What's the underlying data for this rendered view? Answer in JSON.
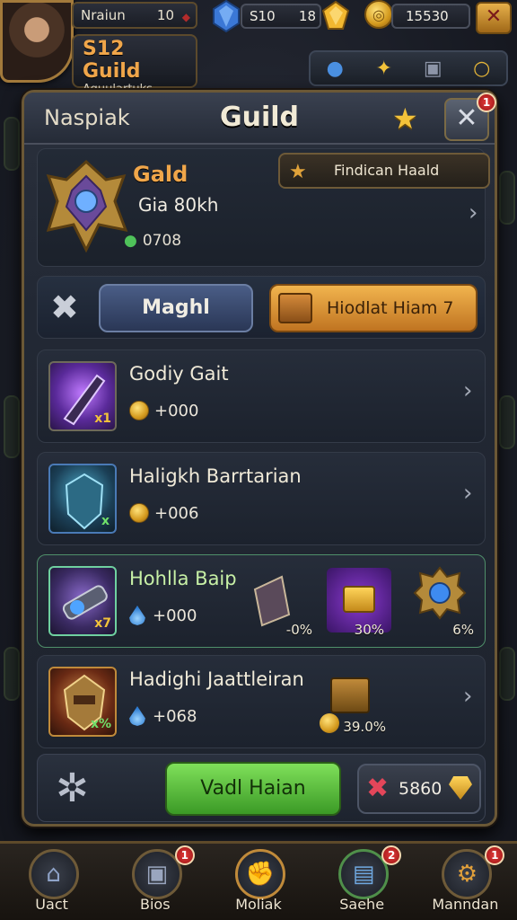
{
  "hud": {
    "player_name": "Nraiun",
    "player_level": "10",
    "guild_tag": "S12 Guild",
    "guild_subtitle": "Aquulartuks",
    "gems": "S10",
    "shards": "18",
    "gold": "15530"
  },
  "panel": {
    "tab_label": "Naspiak",
    "title": "Guild",
    "close_badge": "1"
  },
  "guild": {
    "name": "Gald",
    "description": "Gia 80kh",
    "stat": "0708",
    "tag_button": "Findican Haald"
  },
  "actions": {
    "blue_button": "Maghl",
    "orange_button": "Hiodlat Hiam 7"
  },
  "items": [
    {
      "title": "Godiy Gait",
      "value": "+000",
      "tag": "x1",
      "currency": "coin"
    },
    {
      "title": "Haligkh Barrtarian",
      "value": "+006",
      "tag": "x",
      "currency": "coin"
    },
    {
      "title": "Hohlla Baip",
      "value": "+000",
      "tag": "x7",
      "currency": "drop",
      "rewards": [
        {
          "pct": "-0%"
        },
        {
          "pct": "30%"
        },
        {
          "pct": "6%"
        }
      ]
    },
    {
      "title": "Hadighi Jaattleiran",
      "value": "+068",
      "tag": "x%",
      "currency": "drop",
      "rewards": [
        {
          "pct": "39.0%"
        }
      ]
    }
  ],
  "footer": {
    "green_button": "Vadl Haian",
    "cost": "5860"
  },
  "nav": [
    {
      "label": "Uact",
      "badge": ""
    },
    {
      "label": "Bios",
      "badge": "1"
    },
    {
      "label": "Moliak",
      "badge": ""
    },
    {
      "label": "Saehe",
      "badge": "2"
    },
    {
      "label": "Manndan",
      "badge": "1"
    }
  ],
  "colors": {
    "accent_gold": "#f0a64a",
    "frame": "#6b5836",
    "green_button": "#5fbf3d",
    "orange_button": "#e39a3d",
    "blue_button": "#3d4d72"
  }
}
